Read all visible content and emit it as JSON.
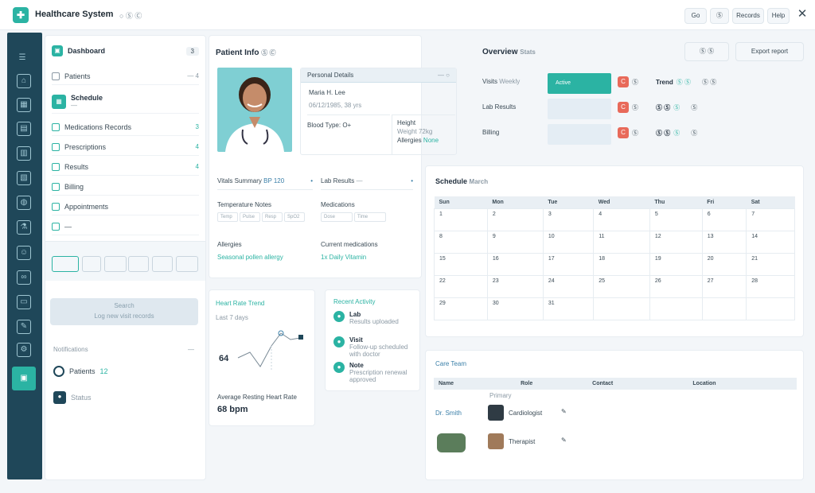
{
  "header": {
    "title": "Healthcare System",
    "subtitle": "○ Ⓢ Ⓒ",
    "btn1": "Go",
    "btn2": "Ⓢ",
    "btn3": "Records",
    "btn4": "Help",
    "close": "✕"
  },
  "sidebar": {
    "top_item": "Dashboard",
    "top_count": "3",
    "item_label_1": "Patients",
    "item_count_1": "— 4",
    "selected_item": "Schedule",
    "selected_sub": "—",
    "items": [
      {
        "label": "Medications Records",
        "count": "3"
      },
      {
        "label": "Prescriptions",
        "count": "4"
      },
      {
        "label": "Results",
        "count": "4"
      },
      {
        "label": "Billing",
        "count": ""
      },
      {
        "label": "Appointments",
        "count": ""
      },
      {
        "label": "—",
        "count": ""
      }
    ],
    "button_main": "Search",
    "button_sub": "Log new visit records",
    "section_title": "Notifications",
    "section_action": "—",
    "notif1_label": "Patients",
    "notif1_badge": "12",
    "notif2_label": "Status"
  },
  "patient": {
    "title": "Patient Info",
    "title_icons": "Ⓢ Ⓒ",
    "header_label": "Personal Details",
    "header_right": "— ○",
    "name": "Maria H. Lee",
    "dob": "06/12/1985, 38 yrs",
    "col1_label": "Blood Type: O+",
    "col2_line1": "Height",
    "col2_line2": "Weight 72kg",
    "col2_line3": "Allergies",
    "col2_line3_val": "None",
    "vitals_title": "Vitals Summary",
    "vitals_value": "BP 120",
    "labs_title": "Lab Results",
    "labs_value": "—",
    "f1_label": "Temperature Notes",
    "f2_label": "Medications",
    "f1_items": [
      "Temp",
      "Pulse",
      "Resp",
      "SpO2"
    ],
    "f2_items": [
      "Dose",
      "Time"
    ],
    "meta1_label": "Allergies",
    "meta1_value": "Seasonal pollen allergy",
    "meta2_label": "Current medications",
    "meta2_value": "1x Daily Vitamin"
  },
  "chart_panel": {
    "title": "Heart Rate Trend",
    "subtitle": "Last 7 days",
    "readout": "64",
    "summary_label": "Average Resting Heart Rate",
    "summary_value": "68 bpm"
  },
  "alerts": {
    "title": "Recent Activity",
    "items": [
      {
        "title": "Lab",
        "desc": "Results uploaded"
      },
      {
        "title": "Visit",
        "desc": "Follow-up scheduled with doctor"
      },
      {
        "title": "Note",
        "desc": "Prescription renewal approved"
      }
    ]
  },
  "overview": {
    "title": "Overview",
    "title_muted": "Stats",
    "btn_icon": "Ⓢ",
    "btn_label": "Ⓢ",
    "btn_add": "Export report",
    "rows": [
      {
        "label": "Visits",
        "sub": "Weekly",
        "bar": "Active",
        "icon": "C",
        "val": "Ⓢ",
        "chip": "Trend",
        "chip_teal": "Ⓢ Ⓢ",
        "action": "Ⓢ Ⓢ"
      },
      {
        "label": "Lab Results",
        "sub": "",
        "bar": "",
        "icon": "C",
        "val": "Ⓢ",
        "chip": "Ⓢ Ⓢ",
        "chip_teal": "Ⓢ",
        "action": "Ⓢ"
      },
      {
        "label": "Billing",
        "sub": "",
        "bar": "",
        "icon": "C",
        "val": "Ⓢ",
        "chip": "Ⓢ Ⓢ",
        "chip_teal": "Ⓢ",
        "action": "Ⓢ"
      }
    ]
  },
  "schedule": {
    "title": "Schedule",
    "title_muted": "March",
    "headers": [
      "Sun",
      "Mon",
      "Tue",
      "Wed",
      "Thu",
      "Fri",
      "Sat"
    ],
    "rows": [
      [
        "1",
        "2",
        "3",
        "4",
        "5",
        "6",
        "7"
      ],
      [
        "8",
        "9",
        "10",
        "11",
        "12",
        "13",
        "14"
      ],
      [
        "15",
        "16",
        "17",
        "18",
        "19",
        "20",
        "21"
      ],
      [
        "22",
        "23",
        "24",
        "25",
        "26",
        "27",
        "28"
      ],
      [
        "29",
        "30",
        "31",
        "",
        "",
        "",
        ""
      ]
    ]
  },
  "providers": {
    "title": "Care Team",
    "headers": [
      "Name",
      "Role",
      "Contact",
      "Location"
    ],
    "sub_header": "Primary",
    "row1_name": "Dr. Smith",
    "row1_role": "Cardiologist",
    "row2_role": "Therapist"
  }
}
